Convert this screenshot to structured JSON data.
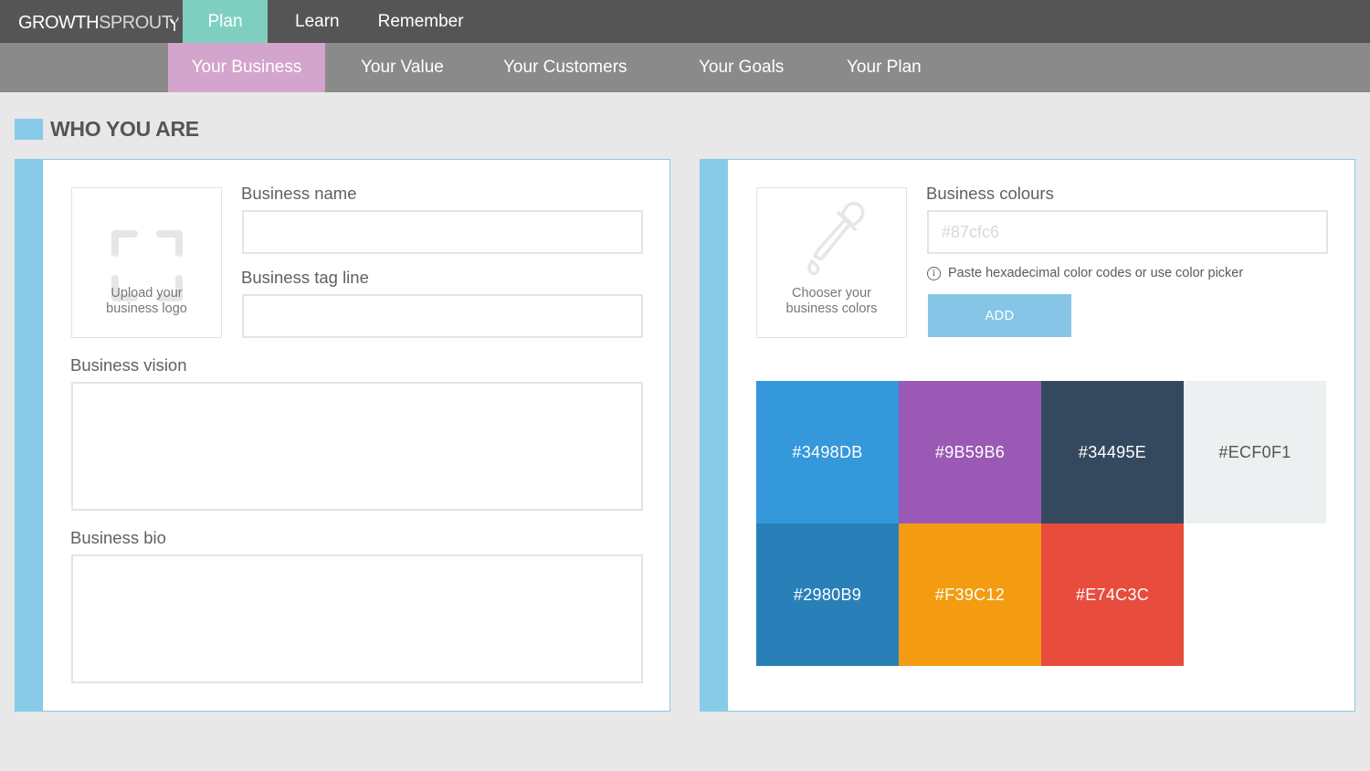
{
  "logo": {
    "part1": "GROWTH",
    "part2": "SPROUT"
  },
  "topnav": [
    {
      "label": "Plan",
      "active": true
    },
    {
      "label": "Learn",
      "active": false
    },
    {
      "label": "Remember",
      "active": false
    }
  ],
  "subnav": [
    {
      "label": "Your Business",
      "active": true
    },
    {
      "label": "Your Value",
      "active": false
    },
    {
      "label": "Your Customers",
      "active": false
    },
    {
      "label": "Your Goals",
      "active": false
    },
    {
      "label": "Your Plan",
      "active": false
    }
  ],
  "section_title": "WHO YOU ARE",
  "left_panel": {
    "upload_logo_line1": "Upload your",
    "upload_logo_line2": "business logo",
    "business_name_label": "Business name",
    "business_name_value": "",
    "tagline_label": "Business tag line",
    "tagline_value": "",
    "vision_label": "Business vision",
    "vision_value": "",
    "bio_label": "Business bio",
    "bio_value": ""
  },
  "right_panel": {
    "chooser_line1": "Chooser your",
    "chooser_line2": "business colors",
    "colours_label": "Business colours",
    "colour_input_placeholder": "#87cfc6",
    "colour_input_value": "",
    "info_text": "Paste hexadecimal color codes or use color picker",
    "add_button": "ADD",
    "swatches": [
      {
        "hex": "#3498DB",
        "text_color": "#ffffff"
      },
      {
        "hex": "#9B59B6",
        "text_color": "#ffffff"
      },
      {
        "hex": "#34495E",
        "text_color": "#ffffff"
      },
      {
        "hex": "#ECF0F1",
        "text_color": "#555555"
      },
      {
        "hex": "#2980B9",
        "text_color": "#ffffff"
      },
      {
        "hex": "#F39C12",
        "text_color": "#ffffff"
      },
      {
        "hex": "#E74C3C",
        "text_color": "#ffffff"
      }
    ]
  },
  "colors": {
    "topbar": "#555555",
    "subbar": "#8a8a8a",
    "plan_active": "#7fcfc1",
    "subnav_active": "#d4a5cc",
    "accent": "#87cbe8"
  }
}
